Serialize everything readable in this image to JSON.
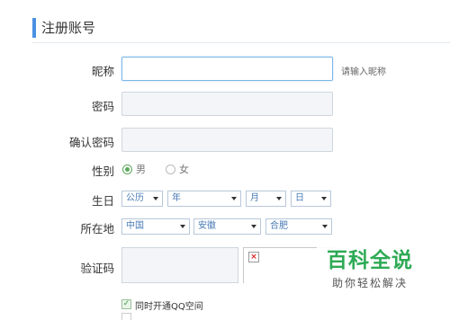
{
  "header": {
    "title": "注册账号"
  },
  "form": {
    "nickname": {
      "label": "昵称",
      "hint": "请输入昵称"
    },
    "password": {
      "label": "密码"
    },
    "confirm_password": {
      "label": "确认密码"
    },
    "gender": {
      "label": "性别",
      "options": [
        "男",
        "女"
      ],
      "selected": "男"
    },
    "birthday": {
      "label": "生日",
      "calendar": "公历",
      "year": "年",
      "month": "月",
      "day": "日"
    },
    "location": {
      "label": "所在地",
      "country": "中国",
      "province": "安徽",
      "city": "合肥"
    },
    "captcha": {
      "label": "验证码",
      "broken_image_mark": "×"
    },
    "qzone": {
      "label": "同时开通QQ空间",
      "checked": true,
      "check_mark": "✓"
    }
  },
  "watermark": {
    "title": "百科全说",
    "subtitle": "助你轻松解决"
  },
  "colors": {
    "accent": "#4a90e2",
    "select_text": "#4a7bb5",
    "watermark": "#2eaa55"
  }
}
